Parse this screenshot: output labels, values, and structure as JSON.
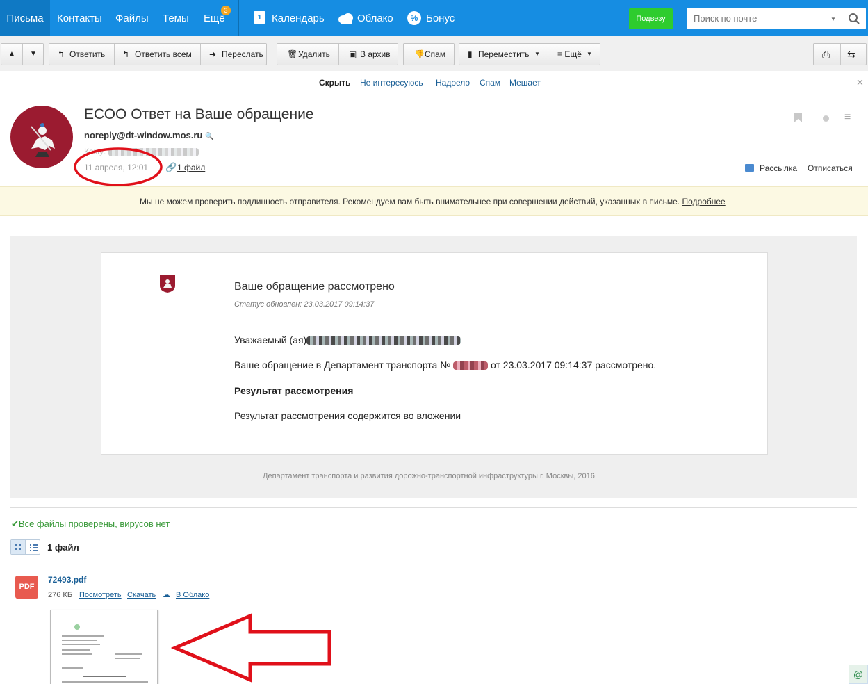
{
  "nav": {
    "items": [
      {
        "label": "Письма"
      },
      {
        "label": "Контакты"
      },
      {
        "label": "Файлы"
      },
      {
        "label": "Темы"
      },
      {
        "label": "Ещё",
        "badge": "3"
      },
      {
        "label": "Календарь"
      },
      {
        "label": "Облако"
      },
      {
        "label": "Бонус"
      }
    ],
    "promo": "Подвезу",
    "search_placeholder": "Поиск по почте",
    "calendar_day": "1"
  },
  "toolbar": {
    "reply": "Ответить",
    "reply_all": "Ответить всем",
    "forward": "Переслать",
    "delete": "Удалить",
    "archive": "В архив",
    "spam": "Спам",
    "move": "Переместить",
    "more": "≡ Ещё"
  },
  "spambar": {
    "hide": "Скрыть",
    "options": [
      "Не интересуюсь",
      "Надоело",
      "Спам",
      "Мешает"
    ]
  },
  "message": {
    "subject": "ЕСОО Ответ на Ваше обращение",
    "sender": "noreply@dt-window.mos.ru",
    "to_label": "Кому:",
    "date": "11 апреля, 12:01",
    "files_link": "1 файл",
    "mailing": "Рассылка",
    "unsubscribe": "Отписаться",
    "warning": "Мы не можем проверить подлинность отправителя. Рекомендуем вам быть внимательнее при совершении действий, указанных в письме.",
    "warning_more": "Подробнее"
  },
  "body": {
    "title": "Ваше обращение рассмотрено",
    "status": "Статус обновлен: 23.03.2017 09:14:37",
    "greeting": "Уважаемый (ая)",
    "line1_prefix": "Ваше обращение в Департамент транспорта №",
    "line1_suffix": "от 23.03.2017 09:14:37 рассмотрено.",
    "result_heading": "Результат рассмотрения",
    "result_text": "Результат рассмотрения содержится во вложении",
    "footer": "Департамент транспорта и развития дорожно-транспортной инфраструктуры г. Москвы, 2016"
  },
  "attachments": {
    "scan_status": "Все файлы проверены, вирусов нет",
    "count": "1 файл",
    "file": {
      "icon_label": "PDF",
      "name": "72493.pdf",
      "size": "276 КБ",
      "view": "Посмотреть",
      "download": "Скачать",
      "to_cloud": "В Облако"
    }
  },
  "colors": {
    "nav_bg": "#168de2",
    "annotation": "#e0101a",
    "promo": "#2ecc2e",
    "pdf": "#e85a4f"
  }
}
